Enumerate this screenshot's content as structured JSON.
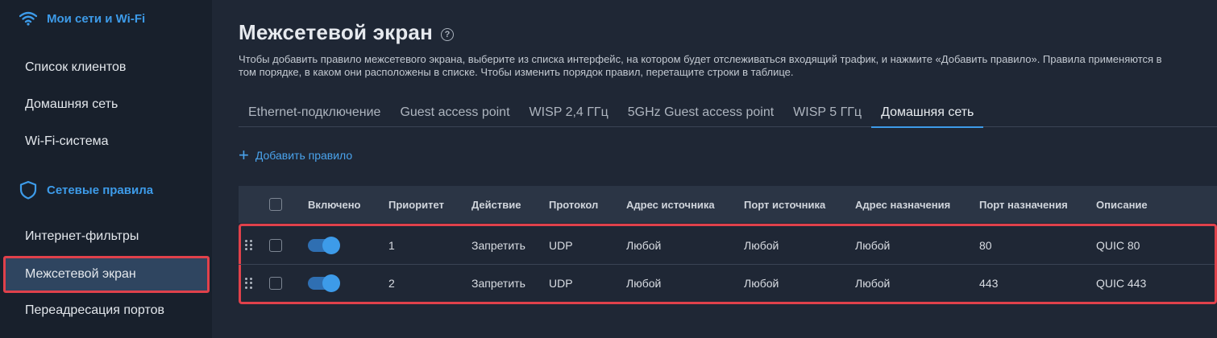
{
  "sidebar": {
    "wifi_section": "Мои сети и Wi-Fi",
    "wifi_items": [
      "Список клиентов",
      "Домашняя сеть",
      "Wi-Fi-система"
    ],
    "rules_section": "Сетевые правила",
    "rules_items": [
      "Интернет-фильтры",
      "Межсетевой экран",
      "Переадресация портов"
    ],
    "active_item": "Межсетевой экран"
  },
  "page": {
    "title": "Межсетевой экран",
    "help_icon": "?",
    "description": "Чтобы добавить правило межсетевого экрана, выберите из списка интерфейс, на котором будет отслеживаться входящий трафик, и нажмите «Добавить правило». Правила применяются в том порядке, в каком они расположены в списке. Чтобы изменить порядок правил, перетащите строки в таблице."
  },
  "tabs": [
    "Ethernet-подключение",
    "Guest access point",
    "WISP 2,4 ГГц",
    "5GHz Guest access point",
    "WISP 5 ГГц",
    "Домашняя сеть"
  ],
  "active_tab": "Домашняя сеть",
  "add_rule": {
    "plus": "+",
    "label": "Добавить правило"
  },
  "table": {
    "columns": [
      "Включено",
      "Приоритет",
      "Действие",
      "Протокол",
      "Адрес источника",
      "Порт источника",
      "Адрес назначения",
      "Порт назначения",
      "Описание"
    ],
    "rows": [
      {
        "enabled": true,
        "priority": "1",
        "action": "Запретить",
        "protocol": "UDP",
        "src_addr": "Любой",
        "src_port": "Любой",
        "dst_addr": "Любой",
        "dst_port": "80",
        "description": "QUIC 80"
      },
      {
        "enabled": true,
        "priority": "2",
        "action": "Запретить",
        "protocol": "UDP",
        "src_addr": "Любой",
        "src_port": "Любой",
        "dst_addr": "Любой",
        "dst_port": "443",
        "description": "QUIC 443"
      }
    ]
  },
  "colors": {
    "accent": "#3d9be9",
    "highlight": "#e0414b",
    "sidebar_bg": "#18202c",
    "main_bg": "#1f2735"
  }
}
